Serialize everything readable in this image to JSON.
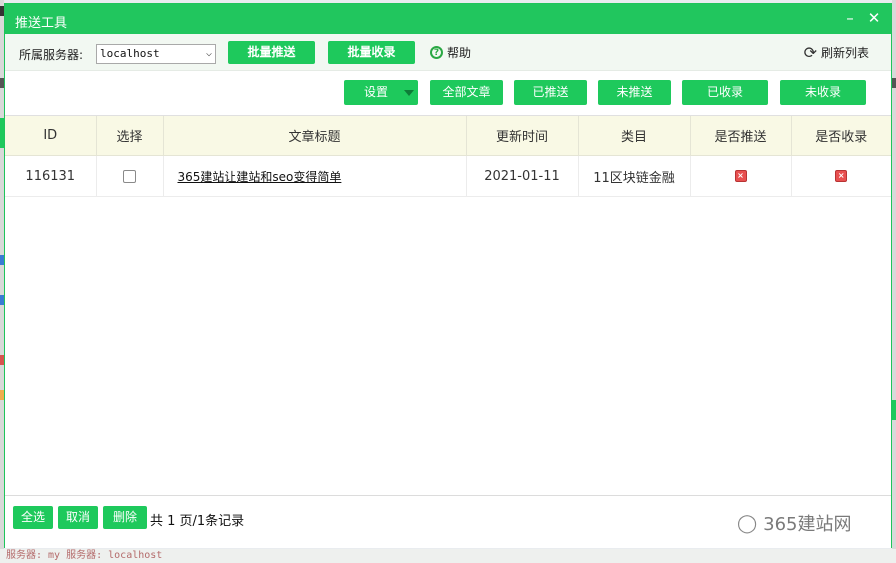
{
  "dialog": {
    "title": "推送工具",
    "minimize_glyph": "–",
    "close_glyph": "✕"
  },
  "toolbar": {
    "server_label": "所属服务器:",
    "server_value": "localhost",
    "batch_push": "批量推送",
    "batch_collect": "批量收录",
    "help": "帮助",
    "refresh": "刷新列表"
  },
  "filters": {
    "settings": "设置",
    "all_articles": "全部文章",
    "pushed": "已推送",
    "not_pushed": "未推送",
    "collected": "已收录",
    "not_collected": "未收录"
  },
  "table": {
    "columns": [
      "ID",
      "选择",
      "文章标题",
      "更新时间",
      "类目",
      "是否推送",
      "是否收录"
    ],
    "rows": [
      {
        "id": "116131",
        "title": "365建站让建站和seo变得简单",
        "updated": "2021-01-11",
        "category": "11区块链金融"
      }
    ]
  },
  "footer": {
    "select_all": "全选",
    "cancel": "取消",
    "delete": "删除",
    "page_info": "共 1 页/1条记录",
    "watermark": "365建站网"
  },
  "background": {
    "status_text": "服务器: my 服务器: localhost"
  },
  "colors": {
    "accent": "#21c65e",
    "header_bg": "#f9f9e5",
    "status_no": "#e85050"
  },
  "icons": {
    "help": "question-circle-icon",
    "refresh": "refresh-icon",
    "status_no": "x-square-icon",
    "watermark": "wechat-icon"
  }
}
